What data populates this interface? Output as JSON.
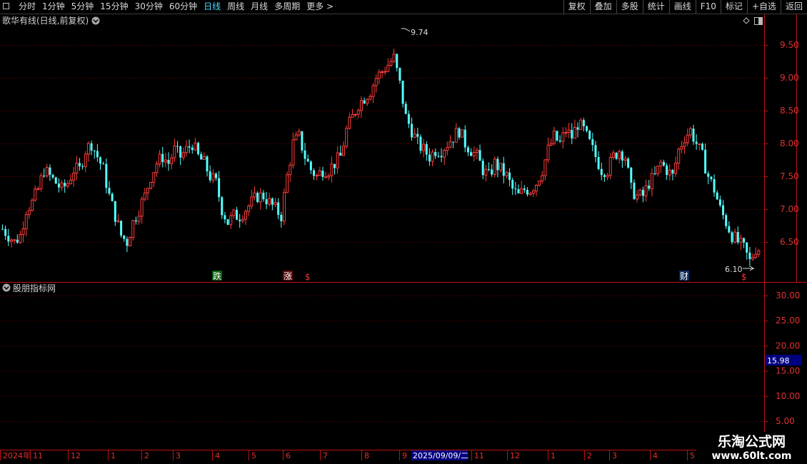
{
  "toolbar": {
    "periods": [
      "分时",
      "1分钟",
      "5分钟",
      "15分钟",
      "30分钟",
      "60分钟",
      "日线",
      "周线",
      "月线",
      "多周期",
      "更多 >"
    ],
    "active_period": "日线",
    "actions": [
      "复权",
      "叠加",
      "多股",
      "统计",
      "画线",
      "F10",
      "标记",
      "+自选",
      "返回"
    ]
  },
  "main_panel": {
    "title": "歌华有线(日线,前复权)",
    "high_label": "9.74",
    "low_label": "6.10",
    "price_axis": [
      "9.50",
      "9.00",
      "8.50",
      "8.00",
      "7.50",
      "7.00",
      "6.50"
    ]
  },
  "signals": {
    "die": "跌",
    "zhang": "涨",
    "cai": "财",
    "dollar": "$"
  },
  "indicator_panel": {
    "title": "股朋指标网",
    "axis": [
      "30.00",
      "25.00",
      "20.00",
      "15.00",
      "10.00",
      "5.00"
    ],
    "current_value": "15.98"
  },
  "time_axis": {
    "labels": [
      "2024年",
      "11",
      "12",
      "1",
      "2",
      "3",
      "4",
      "5",
      "6",
      "7",
      "8",
      "9",
      "11",
      "12",
      "1",
      "2",
      "3",
      "4",
      "5"
    ],
    "cursor_date": "2025/09/09/二"
  },
  "watermark": {
    "line1": "乐淘公式网",
    "line2": "www.60lt.com"
  },
  "colors": {
    "up": "#ff3c3c",
    "down": "#54ffff",
    "grid": "#8b0000",
    "axis": "#c01010",
    "active_tab": "#4fd8ff",
    "value_box": "#000080"
  },
  "chart_data": {
    "type": "candlestick",
    "title": "歌华有线(日线,前复权)",
    "price_range": [
      6.0,
      9.8
    ],
    "high": 9.74,
    "low": 6.1,
    "series": [
      {
        "values": [
          6.7,
          6.6,
          6.5,
          6.6,
          7.0,
          7.1,
          7.3,
          7.6,
          7.5,
          7.4,
          7.3,
          7.4,
          7.6,
          7.6,
          7.9,
          8.0,
          7.8,
          7.6,
          7.2,
          6.9,
          6.6,
          6.5,
          6.8,
          7.0,
          7.2,
          7.5,
          7.7,
          7.8,
          7.7,
          7.9,
          7.8,
          7.9,
          8.0,
          7.8,
          7.7,
          7.5,
          7.4,
          7.0,
          6.8,
          6.9,
          6.9,
          7.0,
          7.1,
          7.2,
          7.2,
          7.1,
          7.0,
          6.9,
          7.5,
          8.0,
          8.1,
          7.8,
          7.6,
          7.5,
          7.6,
          7.6,
          7.7,
          7.8,
          8.2,
          8.4,
          8.6,
          8.7,
          8.8,
          9.0,
          9.1,
          9.2,
          9.3,
          8.9,
          8.4,
          8.2,
          8.0,
          7.9,
          7.8,
          7.9,
          7.9,
          8.0,
          8.1,
          8.2,
          8.0,
          7.9,
          7.8,
          7.6,
          7.5,
          7.7,
          7.6,
          7.5,
          7.3,
          7.2,
          7.3,
          7.3,
          7.4,
          7.6,
          7.9,
          8.1,
          8.0,
          8.2,
          8.1,
          8.3,
          8.2,
          8.0,
          7.8,
          7.6,
          7.6,
          7.8,
          7.9,
          7.8,
          7.3,
          7.2,
          7.2,
          7.4,
          7.5,
          7.7,
          7.6,
          7.5,
          7.9,
          8.1,
          8.2,
          8.0,
          7.8,
          7.5,
          7.3,
          7.0,
          6.8,
          6.6,
          6.5,
          6.4,
          6.2,
          6.4
        ]
      }
    ],
    "indicator": {
      "name": "股朋指标网",
      "current": 15.98,
      "ylim": [
        0,
        33
      ],
      "ticks": [
        5,
        10,
        15,
        20,
        25,
        30
      ]
    }
  }
}
